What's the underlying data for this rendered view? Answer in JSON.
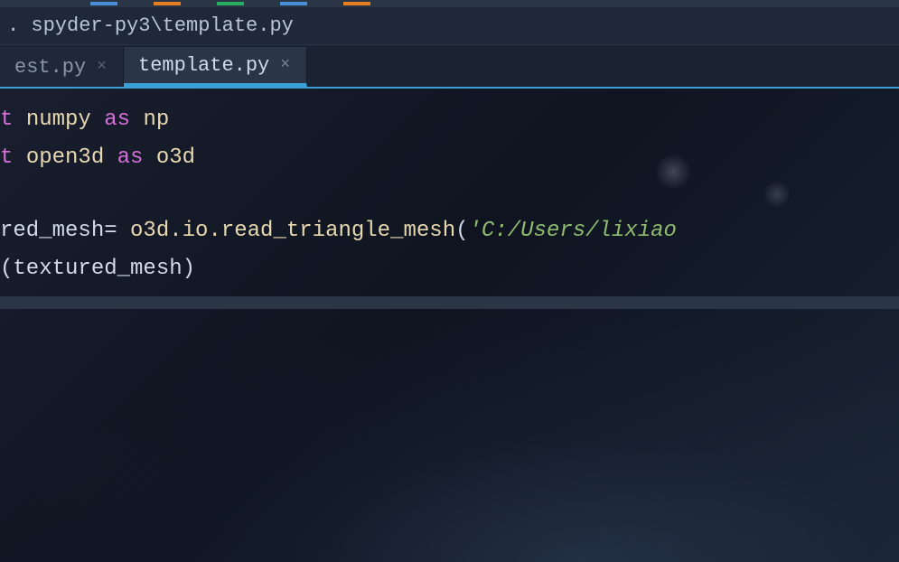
{
  "path": ". spyder-py3\\template.py",
  "tabs": [
    {
      "label": "est.py",
      "active": false
    },
    {
      "label": "template.py",
      "active": true
    }
  ],
  "code": {
    "line1": {
      "kw": "t",
      "mod1": "numpy",
      "as": "as",
      "alias1": "np"
    },
    "line2": {
      "kw": "t",
      "mod2": "open3d",
      "as": "as",
      "alias2": "o3d"
    },
    "line3": {
      "lhs": "red_mesh",
      "eq": "=",
      "call": "o3d.io.read_triangle_mesh",
      "paren_open": "(",
      "str": "'C:/Users/lixiao"
    },
    "line4": {
      "paren_open": "(",
      "arg": "textured_mesh",
      "paren_close": ")"
    }
  }
}
